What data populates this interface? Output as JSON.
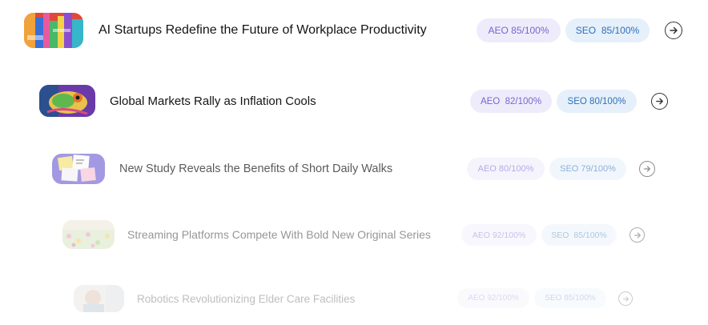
{
  "articles": [
    {
      "title": "AI Startups Redefine the Future of Workplace Productivity",
      "aeo_label": "AEO",
      "aeo_score": "85/100%",
      "seo_label": "SEO",
      "seo_score": "85/100%",
      "thumbnail_icon": "colorful-city-art-thumbnail",
      "arrow_icon": "arrow-right-circle-icon"
    },
    {
      "title": "Global Markets Rally as Inflation Cools",
      "aeo_label": "AEO",
      "aeo_score": "82/100%",
      "seo_label": "SEO",
      "seo_score": "80/100%",
      "thumbnail_icon": "chameleon-art-thumbnail",
      "arrow_icon": "arrow-right-circle-icon"
    },
    {
      "title": "New Study Reveals the Benefits of Short Daily Walks",
      "aeo_label": "AEO",
      "aeo_score": "80/100%",
      "seo_label": "SEO",
      "seo_score": "79/100%",
      "thumbnail_icon": "sticky-notes-thumbnail",
      "arrow_icon": "arrow-right-circle-icon"
    },
    {
      "title": "Streaming Platforms Compete With Bold New Original Series",
      "aeo_label": "AEO",
      "aeo_score": "92/100%",
      "seo_label": "SEO",
      "seo_score": "85/100%",
      "thumbnail_icon": "flower-field-thumbnail",
      "arrow_icon": "arrow-right-circle-icon"
    },
    {
      "title": "Robotics Revolutionizing Elder Care Facilities",
      "aeo_label": "AEO",
      "aeo_score": "92/100%",
      "seo_label": "SEO",
      "seo_score": "85/100%",
      "thumbnail_icon": "portrait-thumbnail",
      "arrow_icon": "arrow-right-circle-icon"
    }
  ],
  "colors": {
    "aeo_bg": "#eeecfb",
    "aeo_text": "#7666cf",
    "seo_bg": "#e5f0fa",
    "seo_text": "#2f6fb8",
    "title_text": "#141414"
  }
}
